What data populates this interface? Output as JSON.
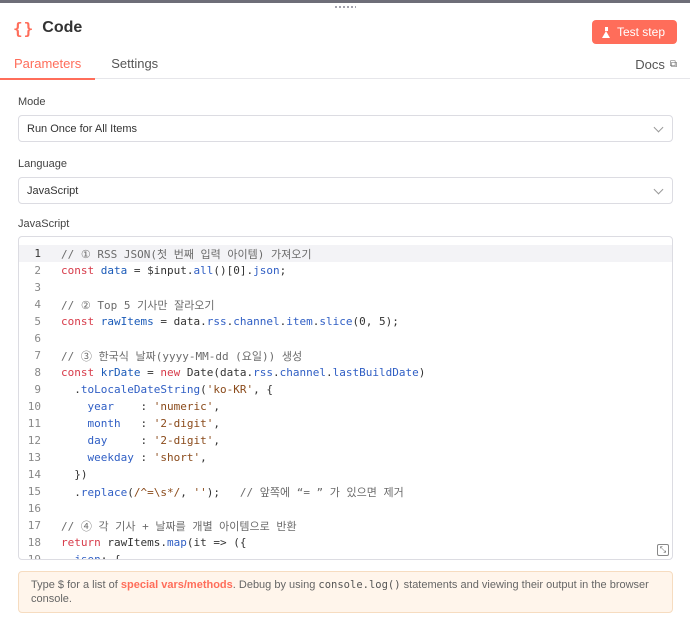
{
  "header": {
    "icon": "{}",
    "title": "Code",
    "test_button": "Test step"
  },
  "tabs": [
    {
      "label": "Parameters",
      "active": true
    },
    {
      "label": "Settings",
      "active": false
    }
  ],
  "docs_link": "Docs",
  "fields": {
    "mode": {
      "label": "Mode",
      "value": "Run Once for All Items"
    },
    "language": {
      "label": "Language",
      "value": "JavaScript"
    },
    "code_label": "JavaScript"
  },
  "code": {
    "active_line": 1,
    "lines": [
      [
        {
          "t": "com",
          "v": "// ① RSS JSON(첫 번째 입력 아이템) 가져오기"
        }
      ],
      [
        {
          "t": "kw",
          "v": "const "
        },
        {
          "t": "var",
          "v": "data"
        },
        {
          "t": "plain",
          "v": " = $input."
        },
        {
          "t": "prop",
          "v": "all"
        },
        {
          "t": "plain",
          "v": "()[0]."
        },
        {
          "t": "prop",
          "v": "json"
        },
        {
          "t": "plain",
          "v": ";"
        }
      ],
      [],
      [
        {
          "t": "com",
          "v": "// ② Top 5 기사만 잘라오기"
        }
      ],
      [
        {
          "t": "kw",
          "v": "const "
        },
        {
          "t": "var",
          "v": "rawItems"
        },
        {
          "t": "plain",
          "v": " = data."
        },
        {
          "t": "prop",
          "v": "rss"
        },
        {
          "t": "plain",
          "v": "."
        },
        {
          "t": "prop",
          "v": "channel"
        },
        {
          "t": "plain",
          "v": "."
        },
        {
          "t": "prop",
          "v": "item"
        },
        {
          "t": "plain",
          "v": "."
        },
        {
          "t": "prop",
          "v": "slice"
        },
        {
          "t": "plain",
          "v": "(0, 5);"
        }
      ],
      [],
      [
        {
          "t": "com",
          "v": "// ③ 한국식 날짜(yyyy-MM-dd (요일)) 생성"
        }
      ],
      [
        {
          "t": "kw",
          "v": "const "
        },
        {
          "t": "var",
          "v": "krDate"
        },
        {
          "t": "plain",
          "v": " = "
        },
        {
          "t": "kw",
          "v": "new "
        },
        {
          "t": "plain",
          "v": "Date(data."
        },
        {
          "t": "prop",
          "v": "rss"
        },
        {
          "t": "plain",
          "v": "."
        },
        {
          "t": "prop",
          "v": "channel"
        },
        {
          "t": "plain",
          "v": "."
        },
        {
          "t": "prop",
          "v": "lastBuildDate"
        },
        {
          "t": "plain",
          "v": ")"
        }
      ],
      [
        {
          "t": "plain",
          "v": "  ."
        },
        {
          "t": "prop",
          "v": "toLocaleDateString"
        },
        {
          "t": "plain",
          "v": "("
        },
        {
          "t": "str",
          "v": "'ko-KR'"
        },
        {
          "t": "plain",
          "v": ", {"
        }
      ],
      [
        {
          "t": "plain",
          "v": "    "
        },
        {
          "t": "prop",
          "v": "year"
        },
        {
          "t": "plain",
          "v": "    : "
        },
        {
          "t": "str",
          "v": "'numeric'"
        },
        {
          "t": "plain",
          "v": ","
        }
      ],
      [
        {
          "t": "plain",
          "v": "    "
        },
        {
          "t": "prop",
          "v": "month"
        },
        {
          "t": "plain",
          "v": "   : "
        },
        {
          "t": "str",
          "v": "'2-digit'"
        },
        {
          "t": "plain",
          "v": ","
        }
      ],
      [
        {
          "t": "plain",
          "v": "    "
        },
        {
          "t": "prop",
          "v": "day"
        },
        {
          "t": "plain",
          "v": "     : "
        },
        {
          "t": "str",
          "v": "'2-digit'"
        },
        {
          "t": "plain",
          "v": ","
        }
      ],
      [
        {
          "t": "plain",
          "v": "    "
        },
        {
          "t": "prop",
          "v": "weekday"
        },
        {
          "t": "plain",
          "v": " : "
        },
        {
          "t": "str",
          "v": "'short'"
        },
        {
          "t": "plain",
          "v": ","
        }
      ],
      [
        {
          "t": "plain",
          "v": "  })"
        }
      ],
      [
        {
          "t": "plain",
          "v": "  ."
        },
        {
          "t": "prop",
          "v": "replace"
        },
        {
          "t": "plain",
          "v": "("
        },
        {
          "t": "str",
          "v": "/^=\\s*/"
        },
        {
          "t": "plain",
          "v": ", "
        },
        {
          "t": "str",
          "v": "''"
        },
        {
          "t": "plain",
          "v": ");   "
        },
        {
          "t": "com",
          "v": "// 앞쪽에 “= ” 가 있으면 제거"
        }
      ],
      [],
      [
        {
          "t": "com",
          "v": "// ④ 각 기사 + 날짜를 개별 아이템으로 반환"
        }
      ],
      [
        {
          "t": "kw",
          "v": "return "
        },
        {
          "t": "plain",
          "v": "rawItems."
        },
        {
          "t": "prop",
          "v": "map"
        },
        {
          "t": "plain",
          "v": "(it => ({"
        }
      ],
      [
        {
          "t": "plain",
          "v": "  "
        },
        {
          "t": "prop",
          "v": "json"
        },
        {
          "t": "plain",
          "v": ": {"
        }
      ]
    ]
  },
  "notice": {
    "prefix": "Type $ for a list of ",
    "highlight": "special vars/methods",
    "middle": ". Debug by using ",
    "mono": "console.log()",
    "suffix": " statements and viewing their output in the browser console."
  },
  "colors": {
    "accent": "#ff6d5a",
    "keyword": "#d73a49",
    "variable": "#1a5ab8",
    "string": "#8a4a1a",
    "notice_bg": "#fff5eb"
  }
}
